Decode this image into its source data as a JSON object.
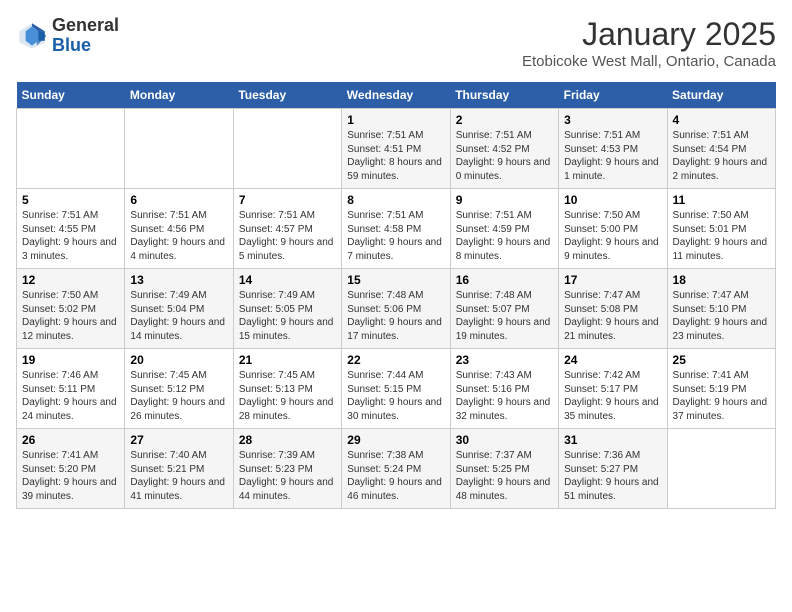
{
  "header": {
    "logo_general": "General",
    "logo_blue": "Blue",
    "month_title": "January 2025",
    "location": "Etobicoke West Mall, Ontario, Canada"
  },
  "weekdays": [
    "Sunday",
    "Monday",
    "Tuesday",
    "Wednesday",
    "Thursday",
    "Friday",
    "Saturday"
  ],
  "weeks": [
    [
      {
        "day": "",
        "info": ""
      },
      {
        "day": "",
        "info": ""
      },
      {
        "day": "",
        "info": ""
      },
      {
        "day": "1",
        "info": "Sunrise: 7:51 AM\nSunset: 4:51 PM\nDaylight: 8 hours and 59 minutes."
      },
      {
        "day": "2",
        "info": "Sunrise: 7:51 AM\nSunset: 4:52 PM\nDaylight: 9 hours and 0 minutes."
      },
      {
        "day": "3",
        "info": "Sunrise: 7:51 AM\nSunset: 4:53 PM\nDaylight: 9 hours and 1 minute."
      },
      {
        "day": "4",
        "info": "Sunrise: 7:51 AM\nSunset: 4:54 PM\nDaylight: 9 hours and 2 minutes."
      }
    ],
    [
      {
        "day": "5",
        "info": "Sunrise: 7:51 AM\nSunset: 4:55 PM\nDaylight: 9 hours and 3 minutes."
      },
      {
        "day": "6",
        "info": "Sunrise: 7:51 AM\nSunset: 4:56 PM\nDaylight: 9 hours and 4 minutes."
      },
      {
        "day": "7",
        "info": "Sunrise: 7:51 AM\nSunset: 4:57 PM\nDaylight: 9 hours and 5 minutes."
      },
      {
        "day": "8",
        "info": "Sunrise: 7:51 AM\nSunset: 4:58 PM\nDaylight: 9 hours and 7 minutes."
      },
      {
        "day": "9",
        "info": "Sunrise: 7:51 AM\nSunset: 4:59 PM\nDaylight: 9 hours and 8 minutes."
      },
      {
        "day": "10",
        "info": "Sunrise: 7:50 AM\nSunset: 5:00 PM\nDaylight: 9 hours and 9 minutes."
      },
      {
        "day": "11",
        "info": "Sunrise: 7:50 AM\nSunset: 5:01 PM\nDaylight: 9 hours and 11 minutes."
      }
    ],
    [
      {
        "day": "12",
        "info": "Sunrise: 7:50 AM\nSunset: 5:02 PM\nDaylight: 9 hours and 12 minutes."
      },
      {
        "day": "13",
        "info": "Sunrise: 7:49 AM\nSunset: 5:04 PM\nDaylight: 9 hours and 14 minutes."
      },
      {
        "day": "14",
        "info": "Sunrise: 7:49 AM\nSunset: 5:05 PM\nDaylight: 9 hours and 15 minutes."
      },
      {
        "day": "15",
        "info": "Sunrise: 7:48 AM\nSunset: 5:06 PM\nDaylight: 9 hours and 17 minutes."
      },
      {
        "day": "16",
        "info": "Sunrise: 7:48 AM\nSunset: 5:07 PM\nDaylight: 9 hours and 19 minutes."
      },
      {
        "day": "17",
        "info": "Sunrise: 7:47 AM\nSunset: 5:08 PM\nDaylight: 9 hours and 21 minutes."
      },
      {
        "day": "18",
        "info": "Sunrise: 7:47 AM\nSunset: 5:10 PM\nDaylight: 9 hours and 23 minutes."
      }
    ],
    [
      {
        "day": "19",
        "info": "Sunrise: 7:46 AM\nSunset: 5:11 PM\nDaylight: 9 hours and 24 minutes."
      },
      {
        "day": "20",
        "info": "Sunrise: 7:45 AM\nSunset: 5:12 PM\nDaylight: 9 hours and 26 minutes."
      },
      {
        "day": "21",
        "info": "Sunrise: 7:45 AM\nSunset: 5:13 PM\nDaylight: 9 hours and 28 minutes."
      },
      {
        "day": "22",
        "info": "Sunrise: 7:44 AM\nSunset: 5:15 PM\nDaylight: 9 hours and 30 minutes."
      },
      {
        "day": "23",
        "info": "Sunrise: 7:43 AM\nSunset: 5:16 PM\nDaylight: 9 hours and 32 minutes."
      },
      {
        "day": "24",
        "info": "Sunrise: 7:42 AM\nSunset: 5:17 PM\nDaylight: 9 hours and 35 minutes."
      },
      {
        "day": "25",
        "info": "Sunrise: 7:41 AM\nSunset: 5:19 PM\nDaylight: 9 hours and 37 minutes."
      }
    ],
    [
      {
        "day": "26",
        "info": "Sunrise: 7:41 AM\nSunset: 5:20 PM\nDaylight: 9 hours and 39 minutes."
      },
      {
        "day": "27",
        "info": "Sunrise: 7:40 AM\nSunset: 5:21 PM\nDaylight: 9 hours and 41 minutes."
      },
      {
        "day": "28",
        "info": "Sunrise: 7:39 AM\nSunset: 5:23 PM\nDaylight: 9 hours and 44 minutes."
      },
      {
        "day": "29",
        "info": "Sunrise: 7:38 AM\nSunset: 5:24 PM\nDaylight: 9 hours and 46 minutes."
      },
      {
        "day": "30",
        "info": "Sunrise: 7:37 AM\nSunset: 5:25 PM\nDaylight: 9 hours and 48 minutes."
      },
      {
        "day": "31",
        "info": "Sunrise: 7:36 AM\nSunset: 5:27 PM\nDaylight: 9 hours and 51 minutes."
      },
      {
        "day": "",
        "info": ""
      }
    ]
  ]
}
